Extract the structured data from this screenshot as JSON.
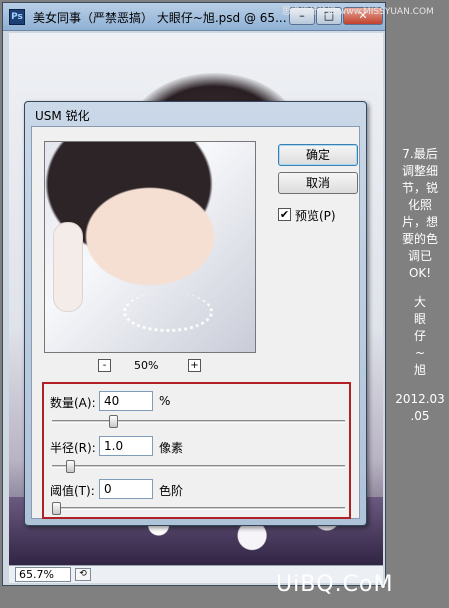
{
  "window": {
    "app_icon": "Ps",
    "title": "美女同事（严禁恶搞） 大眼仔~旭.psd @ 65...",
    "minimize": "–",
    "maximize": "□",
    "close": "✕",
    "zoom_level": "65.7%",
    "status_icon": "⟲"
  },
  "dialog": {
    "title": "USM 锐化",
    "ok_label": "确定",
    "cancel_label": "取消",
    "preview_checked": true,
    "preview_check_mark": "✔",
    "preview_label": "预览(P)",
    "zoom_minus": "-",
    "zoom_plus": "+",
    "preview_zoom": "50%",
    "params": {
      "amount_label": "数量(A):",
      "amount_value": "40",
      "amount_unit": "%",
      "amount_slider_fraction": 0.2,
      "radius_label": "半径(R):",
      "radius_value": "1.0",
      "radius_unit": "像素",
      "radius_slider_fraction": 0.05,
      "threshold_label": "阈值(T):",
      "threshold_value": "0",
      "threshold_unit": "色阶",
      "threshold_slider_fraction": 0.0
    }
  },
  "side_caption": {
    "lines": [
      "7.最后",
      "调整细",
      "节，锐",
      "化照",
      "片，想",
      "要的色",
      "调已",
      "OK!"
    ],
    "author_lines": [
      "大",
      "眼",
      "仔",
      "~",
      "旭"
    ],
    "date_lines": [
      "2012.03",
      ".05"
    ]
  },
  "watermarks": {
    "top": "思缘设计论坛  www.MISSYUAN.COM",
    "bottom": "UiBQ.CoM"
  }
}
